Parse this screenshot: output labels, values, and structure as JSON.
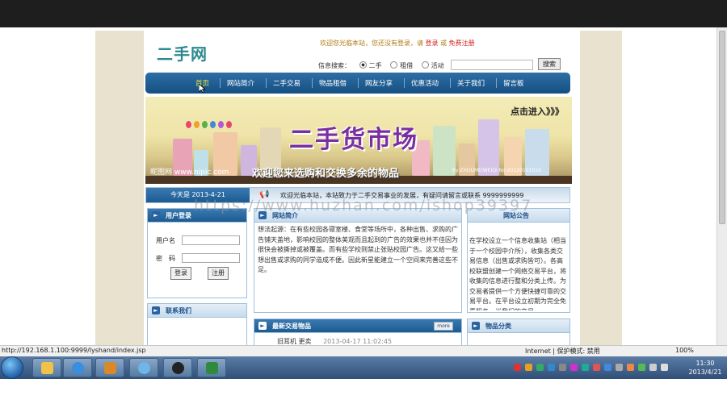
{
  "site": {
    "logo": "二手网",
    "welcome_prefix": "欢迎您光临本站，您还没有登录，请",
    "login_link": "登录",
    "or": "或",
    "register_link": "免费注册",
    "search_label": "信息搜索：",
    "search_options": [
      "二手",
      "租借",
      "活动"
    ],
    "search_button": "搜索",
    "nav": [
      "首页",
      "网站简介",
      "二手交易",
      "物品租借",
      "网友分享",
      "优惠活动",
      "关于我们",
      "留言板"
    ],
    "banner": {
      "title": "二手货市场",
      "subtitle": "欢迎您来选购和交换多余的物品",
      "click_enter": "点击进入》》》",
      "watermark": "昵图网 www.nipic.com",
      "watermark_small": "By:ZHOUMEIWEIQI No:20120101010"
    },
    "date": "今天是 2013-4-21",
    "announcement": "欢迎光临本站，本站致力于二手交易事业的发展，有疑问请留言或联系 9999999999",
    "login_panel": {
      "title": "用户登录",
      "username_label": "用户名",
      "password_label": "密　码",
      "login_button": "登录",
      "register_button": "注册"
    },
    "contact_panel": {
      "title": "联系我们"
    },
    "intro_panel": {
      "title": "网站简介",
      "text": "想法起源：在有些校园各寝室楼、食堂等场所中，各种出售、求购的广告铺天盖地，影响校园的整体美观而且起到的广告的效果也并不佳因为很快会被撕掉或被覆盖。而有些学校则禁止张贴校园广告。这又给一些想出售或求购的同学造成不便。因此新星能建立一个空间来完善这些不足。"
    },
    "notice_panel": {
      "title": "网站公告",
      "text": "在学校设立一个信息收集站（相当于一个校园中介所），收集各类交易信息（出售或求购皆可）。各高校联盟创建一个网络交易平台，将收集的信息进行整和分类上传。为交易者提供一个方便快捷可靠的交易平台。在平台设立初期为完全免费服务，当我们的交易..."
    },
    "latest_panel": {
      "title": "最新交易物品",
      "more": "more",
      "first_item": "旧耳机 更卖",
      "first_date": "2013-04-17 11:02:45"
    },
    "category_panel": {
      "title": "物品分类"
    }
  },
  "overlay_watermark": "https://www.huzhan.com/ishop39397",
  "statusbar": {
    "url": "http://192.168.1.100:9999/lyshand/index.jsp",
    "zone": "Internet | 保护模式: 禁用",
    "zoom": "100%"
  },
  "clock": {
    "time": "11:30",
    "date": "2013/4/21"
  },
  "colors": {
    "nav": "#1b5b92",
    "accent": "#d21f1f",
    "logo": "#2c8a8f",
    "site_bg": "#e9e2cf"
  }
}
